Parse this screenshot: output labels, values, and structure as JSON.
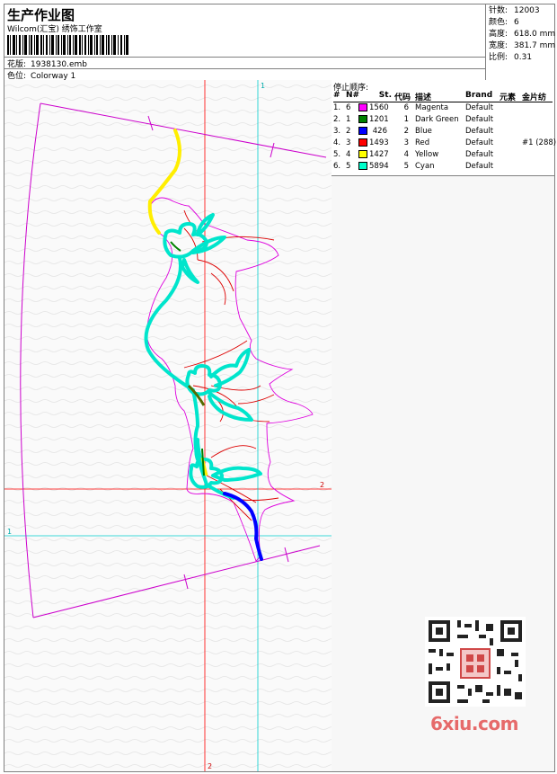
{
  "header": {
    "title": "生产作业图",
    "subtitle": "Wilcom(汇宝) 绣饰工作室",
    "design_label": "花版:",
    "design_value": "1938130.emb",
    "colorway_label": "色位:",
    "colorway_value": "Colorway 1"
  },
  "stats": {
    "stitches_label": "针数:",
    "stitches_value": "12003",
    "colors_label": "颜色:",
    "colors_value": "6",
    "height_label": "高度:",
    "height_value": "618.0 mm",
    "width_label": "宽度:",
    "width_value": "381.7 mm",
    "scale_label": "比例:",
    "scale_value": "0.31"
  },
  "design": {
    "guide_label_1_top": "1",
    "guide_label_1_left": "1",
    "guide_label_2_right": "2",
    "guide_label_2_bottom": "2"
  },
  "stop_sequence": {
    "title": "停止顺序:",
    "columns": [
      "#",
      "N#",
      "St.",
      "代码",
      "描述",
      "Brand",
      "元素",
      "金片纺"
    ],
    "rows": [
      {
        "idx": "1.",
        "n": "6",
        "color": "#ff00ff",
        "st": "1560",
        "code": "6",
        "desc": "Magenta",
        "brand": "Default",
        "elem": "",
        "gold": ""
      },
      {
        "idx": "2.",
        "n": "1",
        "color": "#008000",
        "st": "1201",
        "code": "1",
        "desc": "Dark Green",
        "brand": "Default",
        "elem": "",
        "gold": ""
      },
      {
        "idx": "3.",
        "n": "2",
        "color": "#0000ff",
        "st": "426",
        "code": "2",
        "desc": "Blue",
        "brand": "Default",
        "elem": "",
        "gold": ""
      },
      {
        "idx": "4.",
        "n": "3",
        "color": "#ff0000",
        "st": "1493",
        "code": "3",
        "desc": "Red",
        "brand": "Default",
        "elem": "",
        "gold": "#1 (288)"
      },
      {
        "idx": "5.",
        "n": "4",
        "color": "#ffff00",
        "st": "1427",
        "code": "4",
        "desc": "Yellow",
        "brand": "Default",
        "elem": "",
        "gold": ""
      },
      {
        "idx": "6.",
        "n": "5",
        "color": "#00ffcc",
        "st": "5894",
        "code": "5",
        "desc": "Cyan",
        "brand": "Default",
        "elem": "",
        "gold": ""
      }
    ]
  },
  "watermark": {
    "logo_text": "6xiu.com",
    "qr_icon": "qr-code-icon"
  }
}
